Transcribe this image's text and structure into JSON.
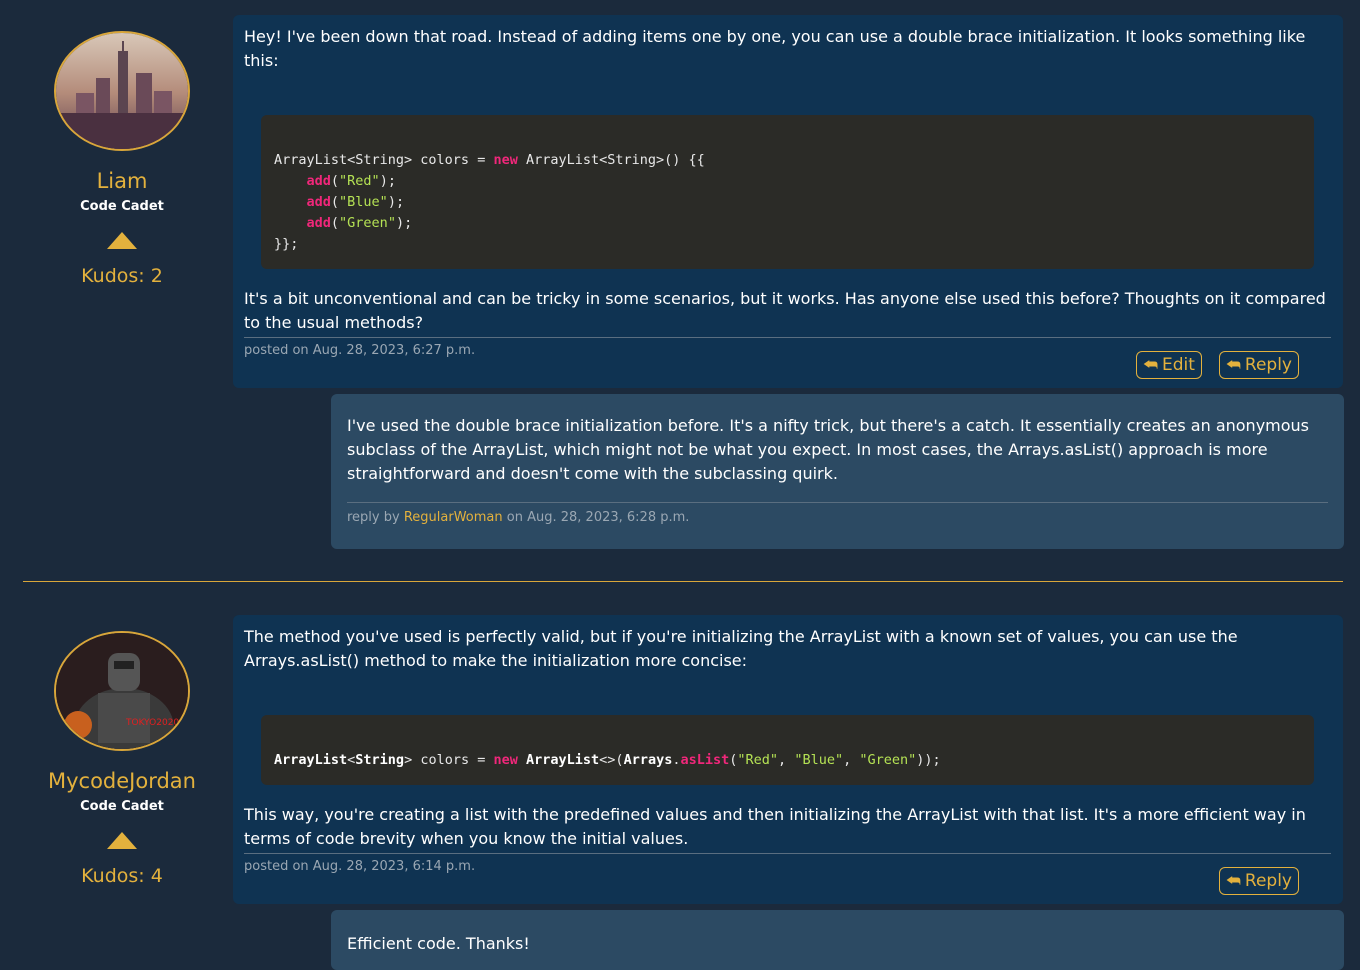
{
  "posts": [
    {
      "user": {
        "name": "Liam",
        "rank": "Code Cadet",
        "kudos": "Kudos: 2"
      },
      "text_before": "Hey! I've been down that road. Instead of adding items one by one, you can use a double brace initialization. It looks something like this:",
      "code_lines": [
        "ArrayList<String> colors = new ArrayList<String>() {{",
        "    add(\"Red\");",
        "    add(\"Blue\");",
        "    add(\"Green\");",
        "}};"
      ],
      "text_after": "It's a bit unconventional and can be tricky in some scenarios, but it works. Has anyone else used this before? Thoughts on it compared to the usual methods?",
      "meta": "posted on Aug. 28, 2023, 6:27 p.m.",
      "edit_label": "Edit",
      "reply_label": "Reply",
      "replies": [
        {
          "text": "I've used the double brace initialization before. It's a nifty trick, but there's a catch. It essentially creates an anonymous subclass of the ArrayList, which might not be what you expect. In most cases, the Arrays.asList() approach is more straightforward and doesn't come with the subclassing quirk.",
          "prefix": "reply by",
          "author": "RegularWoman",
          "suffix": "on Aug. 28, 2023, 6:28 p.m."
        }
      ]
    },
    {
      "user": {
        "name": "MycodeJordan",
        "rank": "Code Cadet",
        "kudos": "Kudos: 4"
      },
      "text_before": "The method you've used is perfectly valid, but if you're initializing the ArrayList with a known set of values, you can use the Arrays.asList() method to make the initialization more concise:",
      "code_line": "ArrayList<String> colors = new ArrayList<>(Arrays.asList(\"Red\", \"Blue\", \"Green\"));",
      "text_after": "This way, you're creating a list with the predefined values and then initializing the ArrayList with that list. It's a more efficient way in terms of code brevity when you know the initial values.",
      "meta": "posted on Aug. 28, 2023, 6:14 p.m.",
      "reply_label": "Reply",
      "replies": [
        {
          "text": "Efficient code. Thanks!"
        }
      ]
    }
  ],
  "colors": {
    "accent": "#e3b13d",
    "background": "#1b2a3c",
    "card": "#0f3352",
    "reply_card": "#2c4a63"
  },
  "icons": {
    "upvote": "triangle-up-icon",
    "edit": "reply-arrow-icon",
    "reply": "reply-arrow-icon"
  }
}
